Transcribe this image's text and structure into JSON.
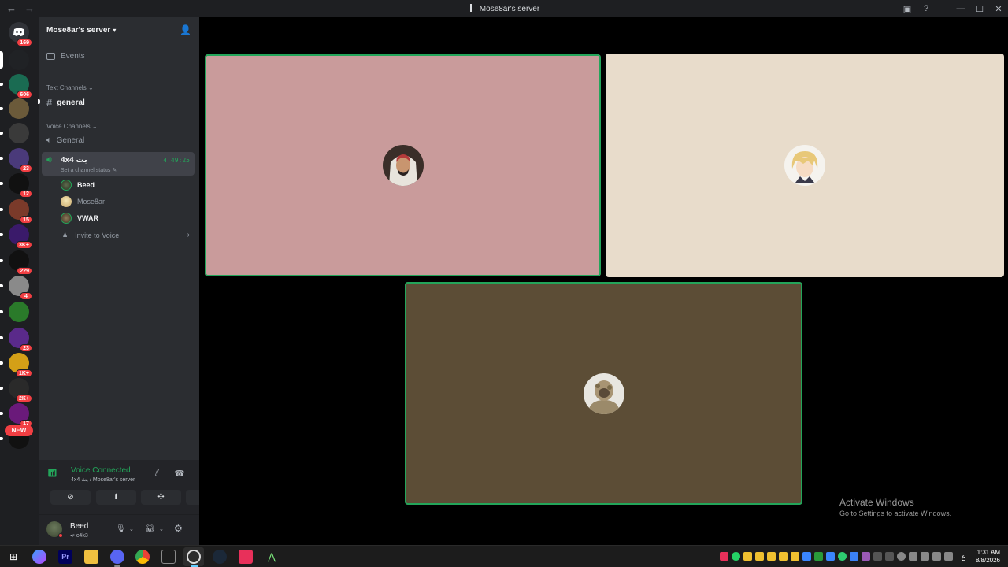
{
  "window": {
    "title": "Mose8ar's server",
    "back_glyph": "←",
    "forward_glyph": "→",
    "controls": [
      "inbox-icon",
      "help-icon",
      "minimize",
      "maximize",
      "close"
    ]
  },
  "rail": {
    "home_badge": "169",
    "servers": [
      {
        "name": "server-1",
        "badge": "",
        "color": "#202225"
      },
      {
        "name": "server-2",
        "badge": "606",
        "color": "#1a6b52"
      },
      {
        "name": "server-3",
        "badge": "",
        "color": "#6b5a3a"
      },
      {
        "name": "server-4",
        "badge": "",
        "color": "#3a3a3a"
      },
      {
        "name": "server-5",
        "badge": "23",
        "color": "#4a3a7a"
      },
      {
        "name": "server-6",
        "badge": "12",
        "color": "#111111"
      },
      {
        "name": "server-7",
        "badge": "15",
        "color": "#7a3a2a"
      },
      {
        "name": "server-8",
        "badge": "3K+",
        "color": "#3a1a6a"
      },
      {
        "name": "server-9",
        "badge": "229",
        "color": "#111111"
      },
      {
        "name": "server-10",
        "badge": "4",
        "color": "#8a8a8a"
      },
      {
        "name": "server-11",
        "badge": "",
        "color": "#2a7a2a"
      },
      {
        "name": "server-12",
        "badge": "23",
        "color": "#5a2a8a"
      },
      {
        "name": "server-13",
        "badge": "1K+",
        "color": "#d4a017"
      },
      {
        "name": "server-14",
        "badge": "2K+",
        "color": "#2a2a2a"
      },
      {
        "name": "server-15",
        "badge": "17",
        "color": "#6a1a7a"
      },
      {
        "name": "server-16",
        "badge": "",
        "color": "#111111"
      }
    ],
    "new_label": "NEW"
  },
  "sidebar": {
    "server_name": "Mose8ar's server",
    "events_label": "Events",
    "text_category": "Text Channels",
    "text_channels": [
      {
        "name": "general"
      }
    ],
    "voice_category": "Voice Channels",
    "voice_channels": [
      {
        "name": "General"
      },
      {
        "name": "4x4 بث",
        "status": "Set a channel status",
        "timer": "4:49:25"
      }
    ],
    "members": [
      {
        "name": "Beed"
      },
      {
        "name": "Mose8ar"
      },
      {
        "name": "VWAR"
      }
    ],
    "invite_label": "Invite to Voice"
  },
  "voice_panel": {
    "title": "Voice Connected",
    "subtitle": "4x4 بث / Mose8ar's server"
  },
  "user": {
    "name": "Beed",
    "status": "c4k3"
  },
  "stage": {
    "tiles": [
      {
        "name": "tile-1",
        "bg": "#c99b9b",
        "speaking": true
      },
      {
        "name": "tile-2",
        "bg": "#e8dccb",
        "speaking": false
      },
      {
        "name": "tile-3",
        "bg": "#5c4d36",
        "speaking": true
      }
    ]
  },
  "watermark": {
    "line1": "Activate Windows",
    "line2": "Go to Settings to activate Windows."
  },
  "taskbar": {
    "time": "1:31 AM",
    "date": "8/8/2026",
    "lang": "ع"
  }
}
